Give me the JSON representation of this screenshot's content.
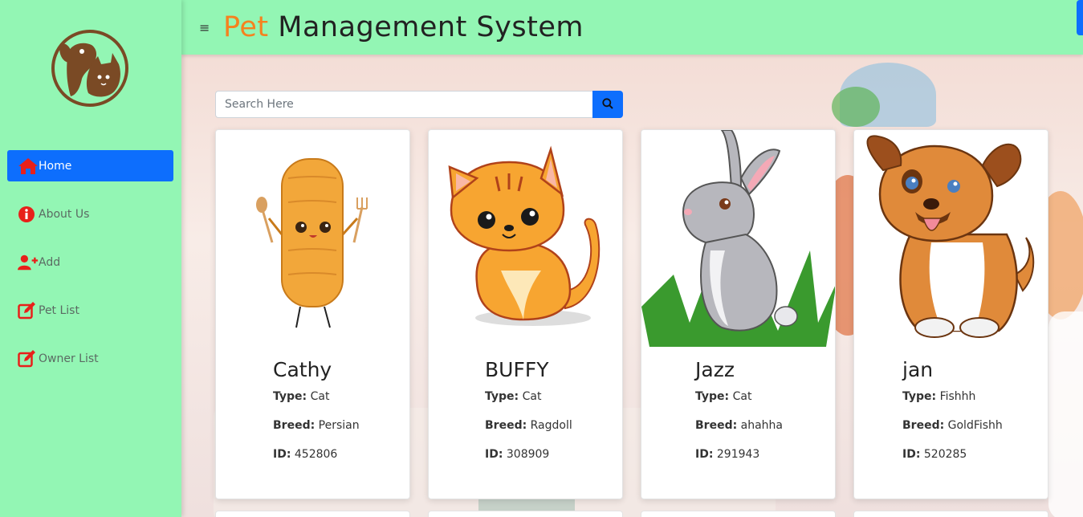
{
  "header": {
    "title_accent": "Pet",
    "title_rest": " Management System",
    "menu_icon": "≡"
  },
  "sidebar": {
    "logo": "pet-logo",
    "items": [
      {
        "label": "Home",
        "icon": "home-icon",
        "active": true
      },
      {
        "label": "About Us",
        "icon": "info-icon",
        "active": false
      },
      {
        "label": "Add",
        "icon": "add-user-icon",
        "active": false
      },
      {
        "label": "Pet List",
        "icon": "edit-icon",
        "active": false
      },
      {
        "label": "Owner List",
        "icon": "edit-icon",
        "active": false
      }
    ]
  },
  "search": {
    "placeholder": "Search Here",
    "value": ""
  },
  "labels": {
    "type": "Type:",
    "breed": "Breed:",
    "id": "ID:"
  },
  "pets": [
    {
      "name": "Cathy",
      "type": "Cat",
      "breed": "Persian",
      "id": "452806",
      "image": "cartoon-churro"
    },
    {
      "name": "BUFFY",
      "type": "Cat",
      "breed": "Ragdoll",
      "id": "308909",
      "image": "cartoon-cat"
    },
    {
      "name": "Jazz",
      "type": "Cat",
      "breed": "ahahha",
      "id": "291943",
      "image": "cartoon-rabbit"
    },
    {
      "name": "jan",
      "type": "Fishhh",
      "breed": "GoldFishh",
      "id": "520285",
      "image": "cartoon-dog"
    }
  ],
  "colors": {
    "sidebar_bg": "#93f6b4",
    "accent_orange": "#f5821f",
    "primary_blue": "#0d6efd",
    "icon_red": "#e8201a",
    "logo_brown": "#7a4a25"
  }
}
